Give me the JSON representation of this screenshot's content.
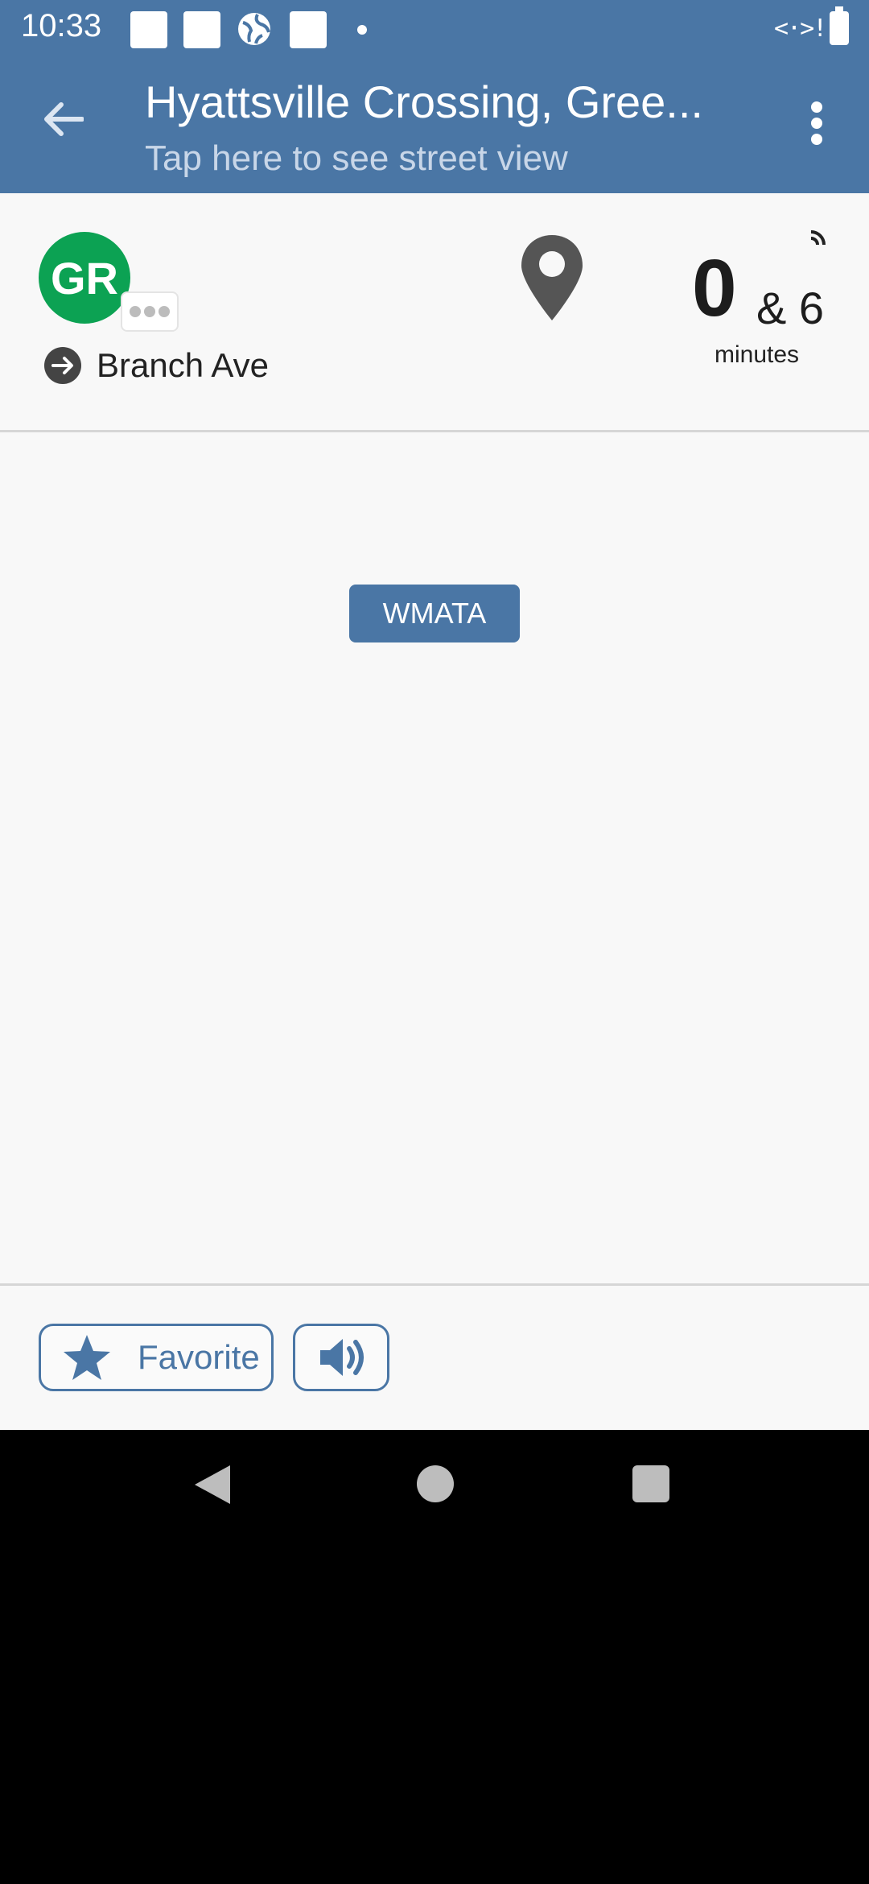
{
  "status_bar": {
    "time": "10:33",
    "icons": [
      "notification-square-icon",
      "notification-square-icon",
      "globe-icon",
      "notification-square-icon",
      "dot-icon",
      "signal-icon",
      "battery-icon"
    ]
  },
  "header": {
    "title": "Hyattsville Crossing, Gree...",
    "subtitle": "Tap here to see street view",
    "back_icon": "arrow-left-icon",
    "menu_icon": "more-vert-icon",
    "color": "#4a76a5"
  },
  "arrival": {
    "route_badge": "GR",
    "route_color": "#0ca253",
    "destination": "Branch Ave",
    "eta_first": "0",
    "eta_rest": "& 6",
    "eta_unit": "minutes",
    "realtime_icon": "realtime-signal-icon",
    "map_icon": "map-pin-icon"
  },
  "agency": {
    "label": "WMATA"
  },
  "actions": {
    "favorite_label": "Favorite",
    "favorite_icon": "star-icon",
    "sound_icon": "volume-icon"
  },
  "nav": {
    "back_icon": "nav-back-icon",
    "home_icon": "nav-home-icon",
    "recent_icon": "nav-recent-icon"
  }
}
